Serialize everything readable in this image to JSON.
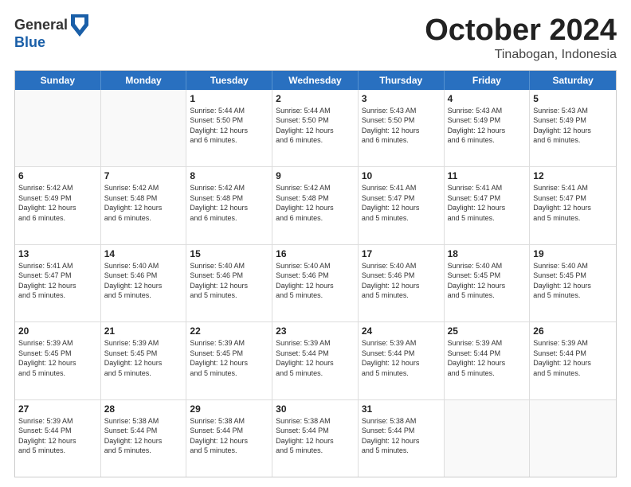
{
  "header": {
    "logo_general": "General",
    "logo_blue": "Blue",
    "month_title": "October 2024",
    "location": "Tinabogan, Indonesia"
  },
  "days_of_week": [
    "Sunday",
    "Monday",
    "Tuesday",
    "Wednesday",
    "Thursday",
    "Friday",
    "Saturday"
  ],
  "weeks": [
    [
      {
        "day": "",
        "info": ""
      },
      {
        "day": "",
        "info": ""
      },
      {
        "day": "1",
        "info": "Sunrise: 5:44 AM\nSunset: 5:50 PM\nDaylight: 12 hours\nand 6 minutes."
      },
      {
        "day": "2",
        "info": "Sunrise: 5:44 AM\nSunset: 5:50 PM\nDaylight: 12 hours\nand 6 minutes."
      },
      {
        "day": "3",
        "info": "Sunrise: 5:43 AM\nSunset: 5:50 PM\nDaylight: 12 hours\nand 6 minutes."
      },
      {
        "day": "4",
        "info": "Sunrise: 5:43 AM\nSunset: 5:49 PM\nDaylight: 12 hours\nand 6 minutes."
      },
      {
        "day": "5",
        "info": "Sunrise: 5:43 AM\nSunset: 5:49 PM\nDaylight: 12 hours\nand 6 minutes."
      }
    ],
    [
      {
        "day": "6",
        "info": "Sunrise: 5:42 AM\nSunset: 5:49 PM\nDaylight: 12 hours\nand 6 minutes."
      },
      {
        "day": "7",
        "info": "Sunrise: 5:42 AM\nSunset: 5:48 PM\nDaylight: 12 hours\nand 6 minutes."
      },
      {
        "day": "8",
        "info": "Sunrise: 5:42 AM\nSunset: 5:48 PM\nDaylight: 12 hours\nand 6 minutes."
      },
      {
        "day": "9",
        "info": "Sunrise: 5:42 AM\nSunset: 5:48 PM\nDaylight: 12 hours\nand 6 minutes."
      },
      {
        "day": "10",
        "info": "Sunrise: 5:41 AM\nSunset: 5:47 PM\nDaylight: 12 hours\nand 5 minutes."
      },
      {
        "day": "11",
        "info": "Sunrise: 5:41 AM\nSunset: 5:47 PM\nDaylight: 12 hours\nand 5 minutes."
      },
      {
        "day": "12",
        "info": "Sunrise: 5:41 AM\nSunset: 5:47 PM\nDaylight: 12 hours\nand 5 minutes."
      }
    ],
    [
      {
        "day": "13",
        "info": "Sunrise: 5:41 AM\nSunset: 5:47 PM\nDaylight: 12 hours\nand 5 minutes."
      },
      {
        "day": "14",
        "info": "Sunrise: 5:40 AM\nSunset: 5:46 PM\nDaylight: 12 hours\nand 5 minutes."
      },
      {
        "day": "15",
        "info": "Sunrise: 5:40 AM\nSunset: 5:46 PM\nDaylight: 12 hours\nand 5 minutes."
      },
      {
        "day": "16",
        "info": "Sunrise: 5:40 AM\nSunset: 5:46 PM\nDaylight: 12 hours\nand 5 minutes."
      },
      {
        "day": "17",
        "info": "Sunrise: 5:40 AM\nSunset: 5:46 PM\nDaylight: 12 hours\nand 5 minutes."
      },
      {
        "day": "18",
        "info": "Sunrise: 5:40 AM\nSunset: 5:45 PM\nDaylight: 12 hours\nand 5 minutes."
      },
      {
        "day": "19",
        "info": "Sunrise: 5:40 AM\nSunset: 5:45 PM\nDaylight: 12 hours\nand 5 minutes."
      }
    ],
    [
      {
        "day": "20",
        "info": "Sunrise: 5:39 AM\nSunset: 5:45 PM\nDaylight: 12 hours\nand 5 minutes."
      },
      {
        "day": "21",
        "info": "Sunrise: 5:39 AM\nSunset: 5:45 PM\nDaylight: 12 hours\nand 5 minutes."
      },
      {
        "day": "22",
        "info": "Sunrise: 5:39 AM\nSunset: 5:45 PM\nDaylight: 12 hours\nand 5 minutes."
      },
      {
        "day": "23",
        "info": "Sunrise: 5:39 AM\nSunset: 5:44 PM\nDaylight: 12 hours\nand 5 minutes."
      },
      {
        "day": "24",
        "info": "Sunrise: 5:39 AM\nSunset: 5:44 PM\nDaylight: 12 hours\nand 5 minutes."
      },
      {
        "day": "25",
        "info": "Sunrise: 5:39 AM\nSunset: 5:44 PM\nDaylight: 12 hours\nand 5 minutes."
      },
      {
        "day": "26",
        "info": "Sunrise: 5:39 AM\nSunset: 5:44 PM\nDaylight: 12 hours\nand 5 minutes."
      }
    ],
    [
      {
        "day": "27",
        "info": "Sunrise: 5:39 AM\nSunset: 5:44 PM\nDaylight: 12 hours\nand 5 minutes."
      },
      {
        "day": "28",
        "info": "Sunrise: 5:38 AM\nSunset: 5:44 PM\nDaylight: 12 hours\nand 5 minutes."
      },
      {
        "day": "29",
        "info": "Sunrise: 5:38 AM\nSunset: 5:44 PM\nDaylight: 12 hours\nand 5 minutes."
      },
      {
        "day": "30",
        "info": "Sunrise: 5:38 AM\nSunset: 5:44 PM\nDaylight: 12 hours\nand 5 minutes."
      },
      {
        "day": "31",
        "info": "Sunrise: 5:38 AM\nSunset: 5:44 PM\nDaylight: 12 hours\nand 5 minutes."
      },
      {
        "day": "",
        "info": ""
      },
      {
        "day": "",
        "info": ""
      }
    ]
  ]
}
